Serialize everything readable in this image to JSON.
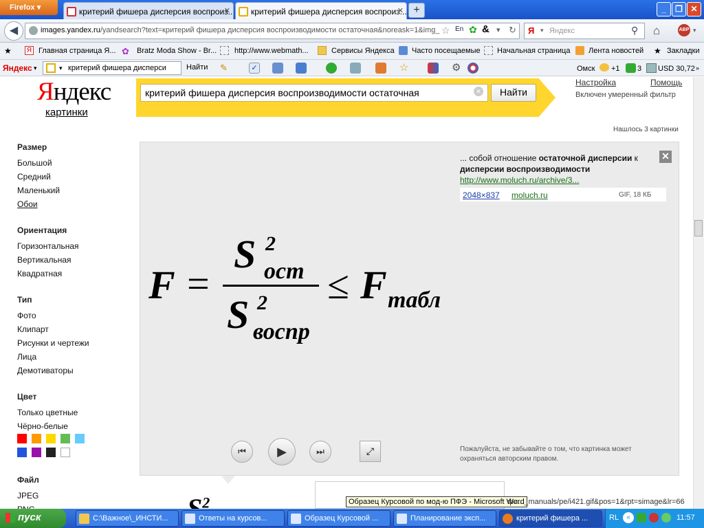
{
  "browser": {
    "app_button": "Firefox",
    "tabs": [
      {
        "label": "критерий фишера дисперсия воспроиз..."
      },
      {
        "label": "критерий фишера дисперсия воспроиз..."
      }
    ],
    "new_tab": "+",
    "url_prefix": "images.yandex.ru",
    "url_rest": "/yandsearch?text=критерий фишера дисперсия воспроизводимости остаточная&noreask=1&img_",
    "search_placeholder": "Яндекс",
    "search_engine_letter": "Я",
    "abp_label": "ABP"
  },
  "bookmarks": [
    {
      "label": "Главная страница Я..."
    },
    {
      "label": "Bratz Moda Show - Br..."
    },
    {
      "label": "http://www.webmath..."
    },
    {
      "label": "Сервисы Яндекса"
    },
    {
      "label": "Часто посещаемые"
    },
    {
      "label": "Начальная страница"
    },
    {
      "label": "Лента новостей"
    },
    {
      "label": "Закладки"
    }
  ],
  "yandex_bar": {
    "logo": "Яндекс",
    "input_value": "критерий фишера дисперси",
    "find": "Найти",
    "city": "Омск",
    "weather": "+1",
    "mail_count": "3",
    "currency": "USD 30,72"
  },
  "page": {
    "logo_first": "Я",
    "logo_rest": "ндекс",
    "logo_sub": "картинки",
    "query": "критерий фишера дисперсия воспроизводимости остаточная",
    "find_button": "Найти",
    "settings": "Настройка",
    "help": "Помощь",
    "filter_note": "Включен умеренный фильтр",
    "found": "Нашлось 3 картинки"
  },
  "sidebar": {
    "size": {
      "heading": "Размер",
      "items": [
        "Большой",
        "Средний",
        "Маленький",
        "Обои"
      ]
    },
    "orientation": {
      "heading": "Ориентация",
      "items": [
        "Горизонтальная",
        "Вертикальная",
        "Квадратная"
      ]
    },
    "type": {
      "heading": "Тип",
      "items": [
        "Фото",
        "Клипарт",
        "Рисунки и чертежи",
        "Лица",
        "Демотиваторы"
      ]
    },
    "color": {
      "heading": "Цвет",
      "items": [
        "Только цветные",
        "Чёрно-белые"
      ],
      "swatches": [
        "#ff0000",
        "#ff9a00",
        "#ffd700",
        "#66bb55",
        "#66ccff",
        "#2255dd",
        "#9911aa",
        "#222222",
        "#ffffff"
      ]
    },
    "file": {
      "heading": "Файл",
      "items": [
        "JPEG",
        "PNG"
      ]
    }
  },
  "viewer": {
    "snippet_pre": "... собой отношение ",
    "snippet_bold1": "остаточной дисперсии",
    "snippet_mid": " к ",
    "snippet_bold2": "дисперсии воспроизводимости",
    "snippet_link": "http://www.moluch.ru/archive/3...",
    "dimensions": "2048×837",
    "host": "moluch.ru",
    "file_type": "GIF, 18 КБ",
    "copyright": "Пожалуйста, не забывайте о том, что картинка может охраняться авторским правом.",
    "formula": {
      "F": "F",
      "eq": "=",
      "num": "S",
      "num_sup": "2",
      "num_sub": "ост",
      "den": "S",
      "den_sup": "2",
      "den_sub": "воспр",
      "le": "≤",
      "rhs": "F",
      "rhs_sub": "табл"
    }
  },
  "below": {
    "peek_formula": "S",
    "peek_sup": "2",
    "tooltip": "Образец Курсовой по мод-ю ПФЭ - Microsoft Word",
    "status_text": "фи..._manuals/pe/i421.gif&pos=1&rpt=simage&lr=66"
  },
  "taskbar": {
    "start": "пуск",
    "tasks": [
      {
        "label": "C:\\Важное\\_ИНСТИ..."
      },
      {
        "label": "Ответы на курсов..."
      },
      {
        "label": "Образец Курсовой ..."
      },
      {
        "label": "Планирование эксп..."
      },
      {
        "label": "критерий фишера ..."
      }
    ],
    "lang": "RL",
    "clock": "11:57"
  }
}
